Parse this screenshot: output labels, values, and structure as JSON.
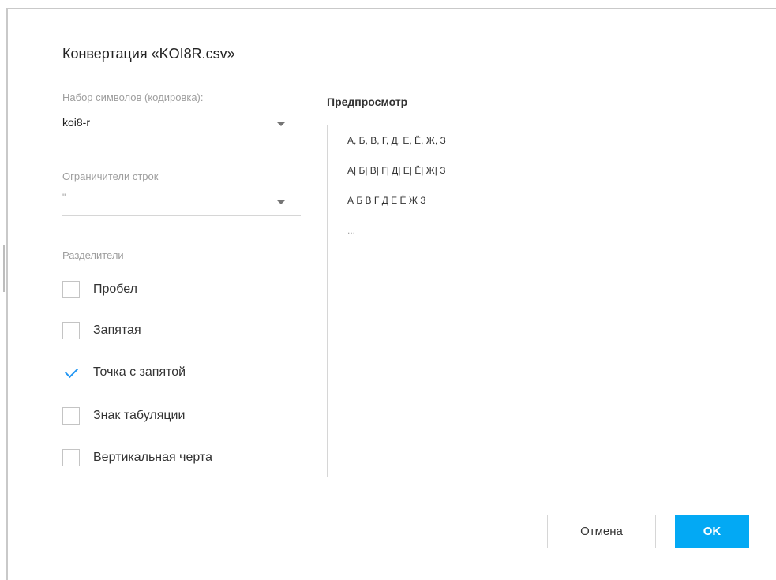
{
  "dialog": {
    "title": "Конвертация «KOI8R.csv»"
  },
  "encoding": {
    "label": "Набор символов (кодировка):",
    "value": "koi8-r"
  },
  "delimiter": {
    "label": "Ограничители строк",
    "value": "\""
  },
  "separators": {
    "label": "Разделители",
    "items": [
      {
        "label": "Пробел",
        "checked": false
      },
      {
        "label": "Запятая",
        "checked": false
      },
      {
        "label": "Точка с запятой",
        "checked": true
      },
      {
        "label": "Знак табуляции",
        "checked": false
      },
      {
        "label": "Вертикальная черта",
        "checked": false
      }
    ]
  },
  "preview": {
    "title": "Предпросмотр",
    "rows": [
      "А, Б, В, Г, Д, Е, Ё, Ж, З",
      "А| Б| В| Г| Д| Е| Ё| Ж| З",
      "А Б В Г Д Е Ё Ж З",
      "..."
    ]
  },
  "buttons": {
    "cancel": "Отмена",
    "ok": "OK"
  },
  "colors": {
    "accent": "#03a9f4",
    "check": "#2196f3"
  }
}
